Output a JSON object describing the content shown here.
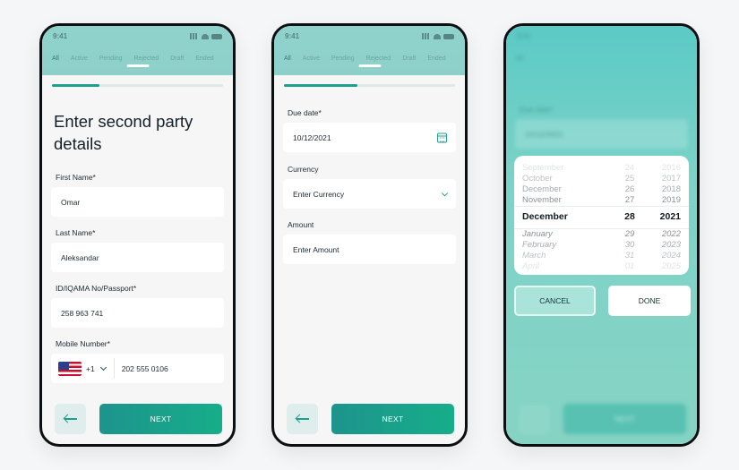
{
  "status_time": "9:41",
  "tabs": [
    "All",
    "Active",
    "Pending",
    "Rejected",
    "Draft",
    "Ended"
  ],
  "screen1": {
    "progress": 0.28,
    "heading": "Enter second party details",
    "fields": [
      {
        "label": "First Name*",
        "value": "Omar"
      },
      {
        "label": "Last Name*",
        "value": "Aleksandar"
      },
      {
        "label": "ID/IQAMA No/Passport*",
        "value": "258 963 741"
      }
    ],
    "mobile": {
      "label": "Mobile Number*",
      "country_code": "+1",
      "number": "202 555 0106",
      "flag": "us-flag"
    },
    "next_label": "NEXT"
  },
  "screen2": {
    "progress": 0.43,
    "due_date": {
      "label": "Due date*",
      "value": "10/12/2021",
      "icon": "calendar-icon"
    },
    "currency": {
      "label": "Currency",
      "placeholder": "Enter Currency",
      "icon": "chevron-down-icon"
    },
    "amount": {
      "label": "Amount",
      "placeholder": "Enter Amount"
    },
    "next_label": "NEXT"
  },
  "screen3": {
    "bg_label": "Due date*",
    "bg_value": "10/12/2021",
    "bg_next": "NEXT",
    "picker_rows": [
      {
        "month": "September",
        "day": "24",
        "year": "2016"
      },
      {
        "month": "October",
        "day": "25",
        "year": "2017"
      },
      {
        "month": "December",
        "day": "26",
        "year": "2018"
      },
      {
        "month": "November",
        "day": "27",
        "year": "2019"
      },
      {
        "month": "December",
        "day": "28",
        "year": "2021",
        "selected": true
      },
      {
        "month": "January",
        "day": "29",
        "year": "2022"
      },
      {
        "month": "February",
        "day": "30",
        "year": "2023"
      },
      {
        "month": "March",
        "day": "31",
        "year": "2024"
      },
      {
        "month": "April",
        "day": "01",
        "year": "2025"
      }
    ],
    "cancel_label": "CANCEL",
    "done_label": "DONE"
  },
  "colors": {
    "accent": "#1f9d90",
    "header": "#8fd3cd",
    "background": "#f6f6f6"
  }
}
